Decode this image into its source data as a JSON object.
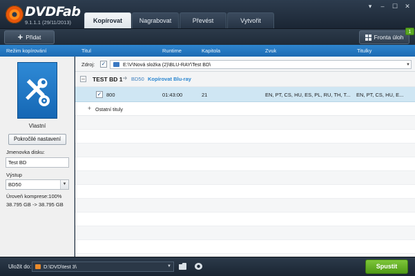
{
  "app": {
    "logo_text": "DVDFab",
    "version": "9.1.1.1 (29/11/2013)"
  },
  "main_tabs": [
    {
      "label": "Kopírovat",
      "active": true
    },
    {
      "label": "Nagrabovat",
      "active": false
    },
    {
      "label": "Převést",
      "active": false
    },
    {
      "label": "Vytvořit",
      "active": false
    }
  ],
  "toolbar": {
    "add_label": "Přidat",
    "queue_label": "Fronta úloh",
    "queue_badge": "1"
  },
  "columns": {
    "mode": "Režim kopírování",
    "title": "Titul",
    "runtime": "Runtime",
    "chapter": "Kapitola",
    "audio": "Zvuk",
    "subtitles": "Titulky"
  },
  "left_panel": {
    "mode_name": "Vlastní",
    "advanced_button": "Pokročilé nastavení",
    "volume_label": "Jmenovka disku:",
    "volume_value": "Test BD",
    "output_label": "Výstup",
    "output_value": "BD50",
    "compression_label": "Úroveň komprese:100%",
    "size_info": "38.795 GB -> 38.795 GB"
  },
  "source": {
    "label": "Zdroj:",
    "path": "E:\\V\\Nová složka (2)\\BLU-RAY\\Test BD\\"
  },
  "title_group": {
    "name": "TEST BD 1",
    "target": "BD50",
    "mode": "Kopírovat Blu-ray"
  },
  "tracks": [
    {
      "title": "800",
      "runtime": "01:43:00",
      "chapters": "21",
      "audio": "EN, PT, CS, HU, ES, PL, RU, TH, T...",
      "subtitles": "EN, PT, CS, HU, E..."
    }
  ],
  "other_titles_label": "Ostatní tituly",
  "bottom": {
    "save_label": "Uložit do:",
    "save_path": "D:\\DVD\\test 3\\",
    "start_label": "Spustit"
  },
  "colors": {
    "accent_blue": "#2a86d0",
    "selection": "#cfe6f3",
    "start_green": "#5fae22"
  }
}
